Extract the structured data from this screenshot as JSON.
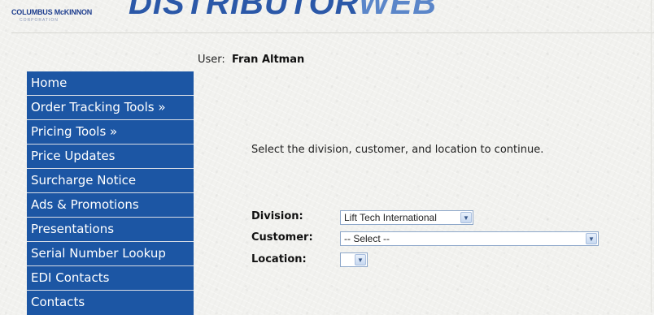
{
  "header": {
    "logo_text": "COLUMBUS McKINNON",
    "logo_sub": "CORPORATION",
    "brand_main": "DISTRIBUTOR",
    "brand_web": "WEB"
  },
  "user": {
    "label": "User:",
    "name": "Fran Altman"
  },
  "sidebar": {
    "items": [
      {
        "label": "Home"
      },
      {
        "label": "Order Tracking Tools »"
      },
      {
        "label": "Pricing Tools »"
      },
      {
        "label": "Price Updates"
      },
      {
        "label": "Surcharge Notice"
      },
      {
        "label": "Ads & Promotions"
      },
      {
        "label": "Presentations"
      },
      {
        "label": "Serial Number Lookup"
      },
      {
        "label": "EDI Contacts"
      },
      {
        "label": "Contacts"
      }
    ]
  },
  "main": {
    "instruction": "Select the division, customer, and location to continue.",
    "division": {
      "label": "Division:",
      "value": "Lift Tech International"
    },
    "customer": {
      "label": "Customer:",
      "value": "-- Select --"
    },
    "location": {
      "label": "Location:",
      "value": ""
    }
  },
  "colors": {
    "nav_bg": "#1c56a4",
    "brand": "#2b58a8"
  },
  "icons": {
    "dropdown": "chevron-down-icon"
  }
}
